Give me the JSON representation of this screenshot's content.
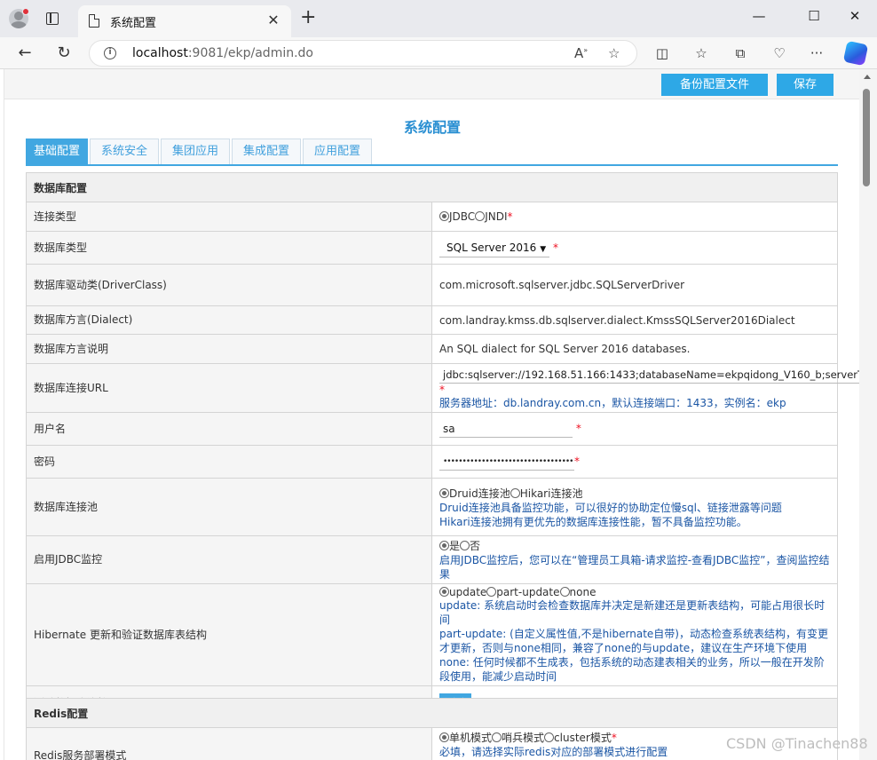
{
  "browser": {
    "tab_title": "系统配置",
    "url_host": "localhost",
    "url_rest": ":9081/ekp/admin.do"
  },
  "toolbar": {
    "backup_label": "备份配置文件",
    "save_label": "保存"
  },
  "page_title": "系统配置",
  "tabs": [
    "基础配置",
    "系统安全",
    "集团应用",
    "集成配置",
    "应用配置"
  ],
  "active_tab": "基础配置",
  "db": {
    "section_title": "数据库配置",
    "conn_type": {
      "label": "连接类型",
      "options": [
        "JDBC",
        "JNDI"
      ],
      "selected": "JDBC",
      "required": "*"
    },
    "db_type": {
      "label": "数据库类型",
      "value": "SQL Server 2016",
      "required": "*"
    },
    "driver": {
      "label": "数据库驱动类(DriverClass)",
      "value": "com.microsoft.sqlserver.jdbc.SQLServerDriver"
    },
    "dialect": {
      "label": "数据库方言(Dialect)",
      "value": "com.landray.kmss.db.sqlserver.dialect.KmssSQLServer2016Dialect"
    },
    "dialect_desc": {
      "label": "数据库方言说明",
      "value": "An SQL dialect for SQL Server 2016 databases."
    },
    "url": {
      "label": "数据库连接URL",
      "value": "jdbc:sqlserver://192.168.51.166:1433;databaseName=ekpqidong_V160_b;serverTimezone=Asia/Shanghai;useSSL=false",
      "required": "*",
      "hint": "服务器地址：db.landray.com.cn，默认连接端口：1433，实例名：ekp"
    },
    "username": {
      "label": "用户名",
      "value": "sa",
      "required": "*"
    },
    "password": {
      "label": "密码",
      "value": "••••••••••••••••••••••••••••••••••••",
      "required": "*"
    },
    "pool": {
      "label": "数据库连接池",
      "options": [
        "Druid连接池",
        "Hikari连接池"
      ],
      "selected": "Druid连接池",
      "hint1": "Druid连接池具备监控功能，可以很好的协助定位慢sql、链接泄露等问题",
      "hint2": "Hikari连接池拥有更优先的数据库连接性能，暂不具备监控功能。"
    },
    "jdbc_monitor": {
      "label": "启用JDBC监控",
      "options": [
        "是",
        "否"
      ],
      "selected": "是",
      "hint": "启用JDBC监控后，您可以在“管理员工具箱-请求监控-查看JDBC监控”，查阅监控结果"
    },
    "hibernate": {
      "label": "Hibernate 更新和验证数据库表结构",
      "options": [
        "update",
        "part-update",
        "none"
      ],
      "selected": "update",
      "hint1": "update: 系统启动时会检查数据库并决定是新建还是更新表结构，可能占用很长时间",
      "hint2": "part-update: (自定义属性值,不是hibernate自带)，动态检查系统表结构，有变更才更新，否则与none相同，兼容了none的与update，建议在生产环境下使用 none: 任何时候都不生成表，包括系统的动态建表相关的业务，所以一般在开发阶段使用，能减少启动时间"
    },
    "test": {
      "label": "测试数据库连接",
      "button": "测试"
    }
  },
  "redis": {
    "section_title": "Redis配置",
    "deploy": {
      "label": "Redis服务部署模式",
      "options": [
        "单机模式",
        "哨兵模式",
        "cluster模式"
      ],
      "selected": "单机模式",
      "required": "*",
      "hint": "必填，请选择实际redis对应的部署模式进行配置"
    }
  },
  "watermark": "CSDN @Tinachen88"
}
